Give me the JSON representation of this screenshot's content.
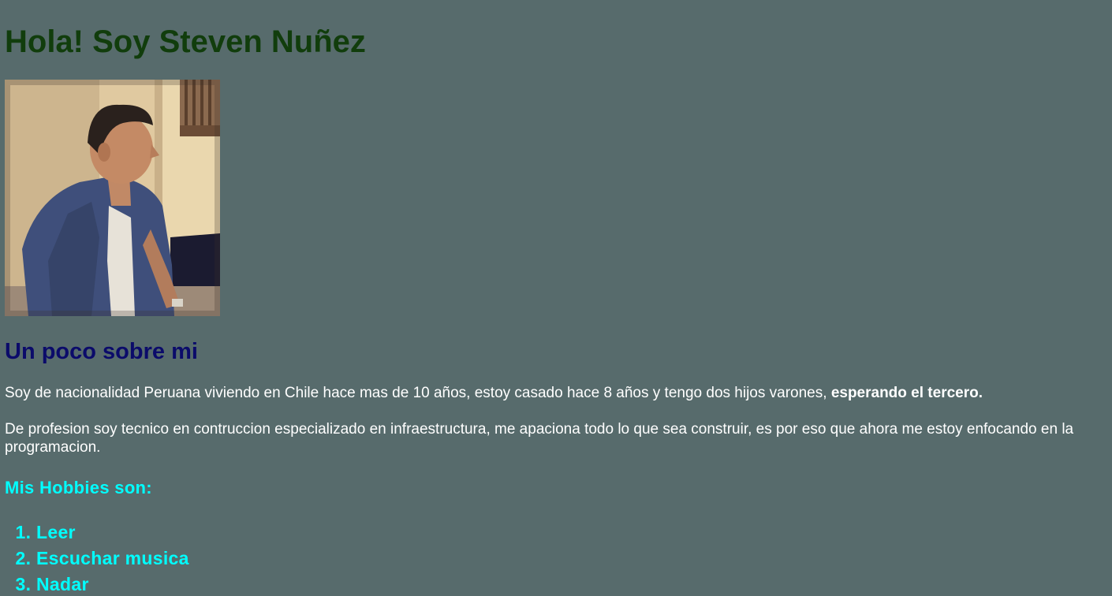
{
  "header": {
    "title": "Hola! Soy Steven Nuñez"
  },
  "photo": {
    "alt": "Foto de Steven Nuñez"
  },
  "about": {
    "heading": "Un poco sobre mi",
    "paragraph1_text": "Soy de nacionalidad Peruana viviendo en Chile hace mas de 10 años, estoy casado hace 8 años y tengo dos hijos varones, ",
    "paragraph1_bold": "esperando el tercero.",
    "paragraph2": "De profesion soy tecnico en contruccion especializado en infraestructura, me apaciona todo lo que sea construir, es por eso que ahora me estoy enfocando en la programacion."
  },
  "hobbies": {
    "heading": "Mis Hobbies son:",
    "items": [
      "Leer",
      "Escuchar musica",
      "Nadar"
    ]
  },
  "colors": {
    "background": "#576b6c",
    "title": "#113d0c",
    "subheading": "#0b0b6a",
    "accent": "#00ffff",
    "text": "#ffffff"
  }
}
